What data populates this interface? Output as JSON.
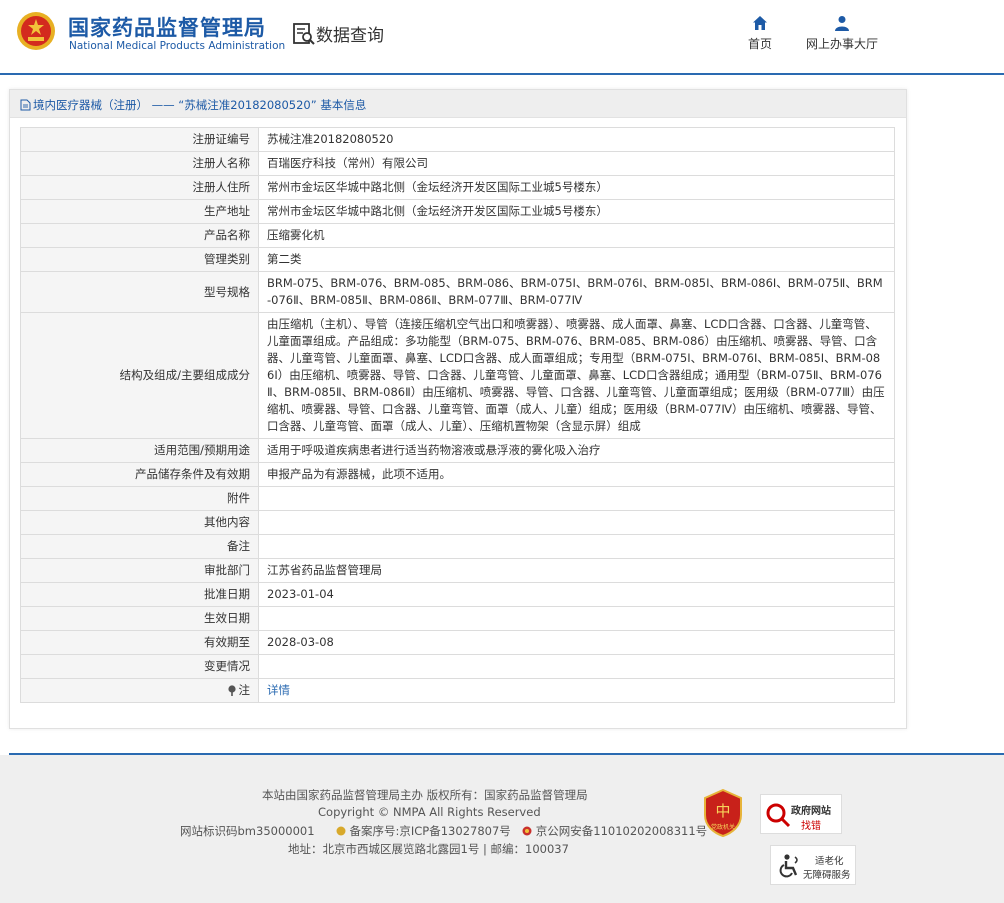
{
  "header": {
    "site_title_cn": "国家药品监督管理局",
    "site_title_en": "National Medical Products Administration",
    "query_title": "数据查询",
    "nav": {
      "home": "首页",
      "online_hall": "网上办事大厅"
    }
  },
  "panel": {
    "breadcrumb": "境内医疗器械（注册） —— “苏械注准20182080520” 基本信息"
  },
  "records": [
    {
      "label": "注册证编号",
      "value": "苏械注准20182080520"
    },
    {
      "label": "注册人名称",
      "value": "百瑞医疗科技（常州）有限公司"
    },
    {
      "label": "注册人住所",
      "value": "常州市金坛区华城中路北侧（金坛经济开发区国际工业城5号楼东）"
    },
    {
      "label": "生产地址",
      "value": "常州市金坛区华城中路北侧（金坛经济开发区国际工业城5号楼东）"
    },
    {
      "label": "产品名称",
      "value": "压缩雾化机"
    },
    {
      "label": "管理类别",
      "value": "第二类"
    },
    {
      "label": "型号规格",
      "value": "BRM-075、BRM-076、BRM-085、BRM-086、BRM-075Ⅰ、BRM-076Ⅰ、BRM-085Ⅰ、BRM-086Ⅰ、BRM-075Ⅱ、BRM-076Ⅱ、BRM-085Ⅱ、BRM-086Ⅱ、BRM-077Ⅲ、BRM-077Ⅳ"
    },
    {
      "label": "结构及组成/主要组成成分",
      "value": "由压缩机（主机）、导管（连接压缩机空气出口和喷雾器）、喷雾器、成人面罩、鼻塞、LCD口含器、口含器、儿童弯管、儿童面罩组成。产品组成：多功能型（BRM-075、BRM-076、BRM-085、BRM-086）由压缩机、喷雾器、导管、口含器、儿童弯管、儿童面罩、鼻塞、LCD口含器、成人面罩组成；专用型（BRM-075Ⅰ、BRM-076Ⅰ、BRM-085Ⅰ、BRM-086Ⅰ）由压缩机、喷雾器、导管、口含器、儿童弯管、儿童面罩、鼻塞、LCD口含器组成；通用型（BRM-075Ⅱ、BRM-076Ⅱ、BRM-085Ⅱ、BRM-086Ⅱ）由压缩机、喷雾器、导管、口含器、儿童弯管、儿童面罩组成；医用级（BRM-077Ⅲ）由压缩机、喷雾器、导管、口含器、儿童弯管、面罩（成人、儿童）组成；医用级（BRM-077Ⅳ）由压缩机、喷雾器、导管、口含器、儿童弯管、面罩（成人、儿童）、压缩机置物架（含显示屏）组成"
    },
    {
      "label": "适用范围/预期用途",
      "value": "适用于呼吸道疾病患者进行适当药物溶液或悬浮液的雾化吸入治疗"
    },
    {
      "label": "产品储存条件及有效期",
      "value": "申报产品为有源器械，此项不适用。"
    },
    {
      "label": "附件",
      "value": ""
    },
    {
      "label": "其他内容",
      "value": ""
    },
    {
      "label": "备注",
      "value": ""
    },
    {
      "label": "审批部门",
      "value": "江苏省药品监督管理局"
    },
    {
      "label": "批准日期",
      "value": "2023-01-04"
    },
    {
      "label": "生效日期",
      "value": ""
    },
    {
      "label": "有效期至",
      "value": "2028-03-08"
    },
    {
      "label": "变更情况",
      "value": ""
    }
  ],
  "note_row": {
    "label": "注",
    "link_text": "详情"
  },
  "footer": {
    "line1": "本站由国家药品监督管理局主办 版权所有：国家药品监督管理局",
    "line2": "Copyright © NMPA All Rights Reserved",
    "line3_site_id": "网站标识码bm35000001",
    "line3_icp": "备案序号:京ICP备13027807号",
    "line3_police": "京公网安备11010202008311号",
    "line4": "地址：北京市西城区展览路北露园1号 | 邮编：100037",
    "badge_party": "党政机关",
    "badge_gov_title": "政府网站",
    "badge_gov_sub": "找错",
    "badge_acc_line1": "适老化",
    "badge_acc_line2": "无障碍服务"
  },
  "colors": {
    "brand_blue": "#1d5aa6",
    "link_blue": "#2a6ab1",
    "emblem_red": "#d32a1e"
  },
  "icons": [
    "emblem-icon",
    "data-query-icon",
    "home-icon",
    "user-icon",
    "document-icon",
    "note-pin-icon",
    "party-emblem-icon",
    "gov-site-icon",
    "accessibility-icon",
    "police-icon"
  ]
}
